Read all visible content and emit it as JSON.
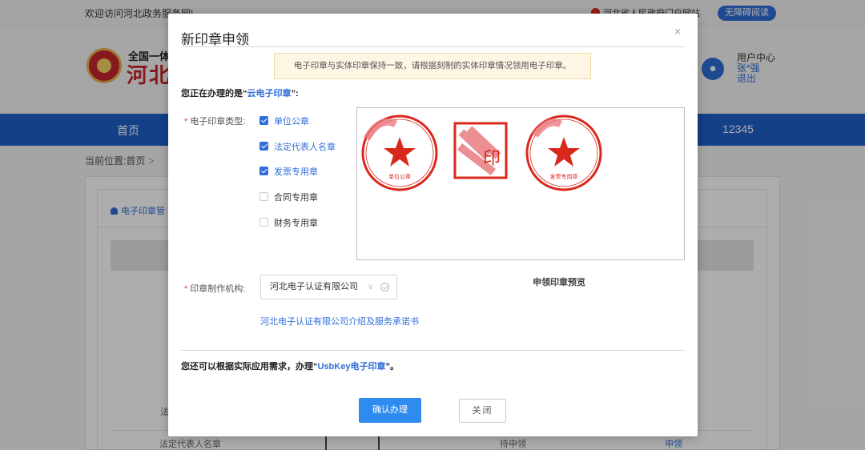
{
  "topbar": {
    "welcome": "欢迎访问河北政务服务网!",
    "gov_link": "河北省人民政府门户网站",
    "accessibility": "无障碍阅读"
  },
  "header": {
    "logo_line1": "全国一体",
    "logo_line2": "河北",
    "user_center": "用户中心",
    "user_name": "张*强",
    "logout": "退出"
  },
  "nav": {
    "home": "首页",
    "hotline": "12345"
  },
  "breadcrumb": {
    "label": "当前位置:首页",
    "sep": ">"
  },
  "background": {
    "tab_label": "电子印章管",
    "row_partial_label": "法",
    "row": {
      "seal_name": "法定代表人名章",
      "status": "待申领",
      "action": "申领"
    }
  },
  "modal": {
    "title": "新印章申领",
    "close": "×",
    "notice": "电子印章与实体印章保持一致，请根据刻制的实体印章情况领用电子印章。",
    "processing_prefix": "您正在办理的是“",
    "processing_highlight": "云电子印章",
    "processing_suffix": "”:",
    "seal_type_label": "电子印章类型:",
    "required_mark": "*",
    "seal_types": [
      {
        "label": "单位公章",
        "checked": true
      },
      {
        "label": "法定代表人名章",
        "checked": true
      },
      {
        "label": "发票专用章",
        "checked": true
      },
      {
        "label": "合同专用章",
        "checked": false
      },
      {
        "label": "财务专用章",
        "checked": false
      }
    ],
    "preview_seals": {
      "seal1_text": "单位公章",
      "seal2_text": "印",
      "seal3_text": "发票专用章"
    },
    "org_label": "印章制作机构:",
    "org_value": "河北电子认证有限公司",
    "org_arrow": "∨",
    "preview_label": "申领印章预览",
    "org_link": "河北电子认证有限公司介绍及服务承诺书",
    "usbkey_prefix": "您还可以根据实际应用需求，办理“",
    "usbkey_highlight": "UsbKey电子印章",
    "usbkey_suffix": "”。",
    "confirm_button": "确认办理",
    "close_button": "关闭"
  },
  "colors": {
    "primary": "#2f6ed8",
    "nav_bg": "#1d5fc8",
    "seal_red": "#d9291c",
    "confirm_bg": "#2f8bf0"
  }
}
